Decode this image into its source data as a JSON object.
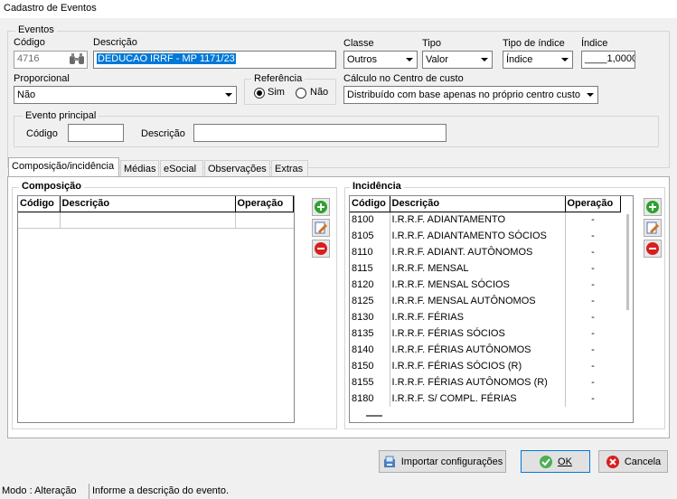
{
  "window": {
    "title": "Cadastro de Eventos"
  },
  "eventos": {
    "group_label": "Eventos",
    "codigo_label": "Código",
    "codigo_value": "4716",
    "descricao_label": "Descrição",
    "descricao_value": "DEDUCAO IRRF - MP 1171/23",
    "classe_label": "Classe",
    "classe_value": "Outros",
    "tipo_label": "Tipo",
    "tipo_value": "Valor",
    "tipo_indice_label": "Tipo de índice",
    "tipo_indice_value": "Índice",
    "indice_label": "Índice",
    "indice_value": "____1,0000",
    "proporcional_label": "Proporcional",
    "proporcional_value": "Não",
    "referencia_label": "Referência",
    "referencia_sim": "Sim",
    "referencia_nao": "Não",
    "calculo_label": "Cálculo no Centro de custo",
    "calculo_value": "Distribuído com base apenas no próprio centro custo"
  },
  "evento_principal": {
    "group_label": "Evento principal",
    "codigo_label": "Código",
    "codigo_value": "",
    "descricao_label": "Descrição",
    "descricao_value": ""
  },
  "tabs": [
    {
      "label": "Composição/incidência"
    },
    {
      "label": "Médias"
    },
    {
      "label": "eSocial"
    },
    {
      "label": "Observações"
    },
    {
      "label": "Extras"
    }
  ],
  "composicao": {
    "label": "Composição",
    "columns": [
      "Código",
      "Descrição",
      "Operação"
    ]
  },
  "incidencia": {
    "label": "Incidência",
    "columns": [
      "Código",
      "Descrição",
      "Operação"
    ],
    "rows": [
      {
        "codigo": "8100",
        "descricao": "I.R.R.F. ADIANTAMENTO",
        "operacao": "-"
      },
      {
        "codigo": "8105",
        "descricao": "I.R.R.F. ADIANTAMENTO SÓCIOS",
        "operacao": "-"
      },
      {
        "codigo": "8110",
        "descricao": "I.R.R.F. ADIANT. AUTÔNOMOS",
        "operacao": "-"
      },
      {
        "codigo": "8115",
        "descricao": "I.R.R.F. MENSAL",
        "operacao": "-"
      },
      {
        "codigo": "8120",
        "descricao": "I.R.R.F. MENSAL SÓCIOS",
        "operacao": "-"
      },
      {
        "codigo": "8125",
        "descricao": "I.R.R.F. MENSAL AUTÔNOMOS",
        "operacao": "-"
      },
      {
        "codigo": "8130",
        "descricao": "I.R.R.F. FÉRIAS",
        "operacao": "-"
      },
      {
        "codigo": "8135",
        "descricao": "I.R.R.F. FÉRIAS SÓCIOS",
        "operacao": "-"
      },
      {
        "codigo": "8140",
        "descricao": "I.R.R.F. FÉRIAS AUTÔNOMOS",
        "operacao": "-"
      },
      {
        "codigo": "8150",
        "descricao": "I.R.R.F. FÉRIAS SÓCIOS (R)",
        "operacao": "-"
      },
      {
        "codigo": "8155",
        "descricao": "I.R.R.F. FÉRIAS AUTÔNOMOS (R)",
        "operacao": "-"
      },
      {
        "codigo": "8180",
        "descricao": "I.R.R.F. S/ COMPL. FÉRIAS",
        "operacao": "-"
      }
    ]
  },
  "buttons": {
    "importar": "Importar configurações",
    "ok": "OK",
    "cancela": "Cancela"
  },
  "status": {
    "modo": "Modo : Alteração",
    "hint": "Informe a descrição do evento."
  },
  "colors": {
    "selection": "#0078d7",
    "add": "#2fa12f",
    "remove": "#d81e1e"
  }
}
